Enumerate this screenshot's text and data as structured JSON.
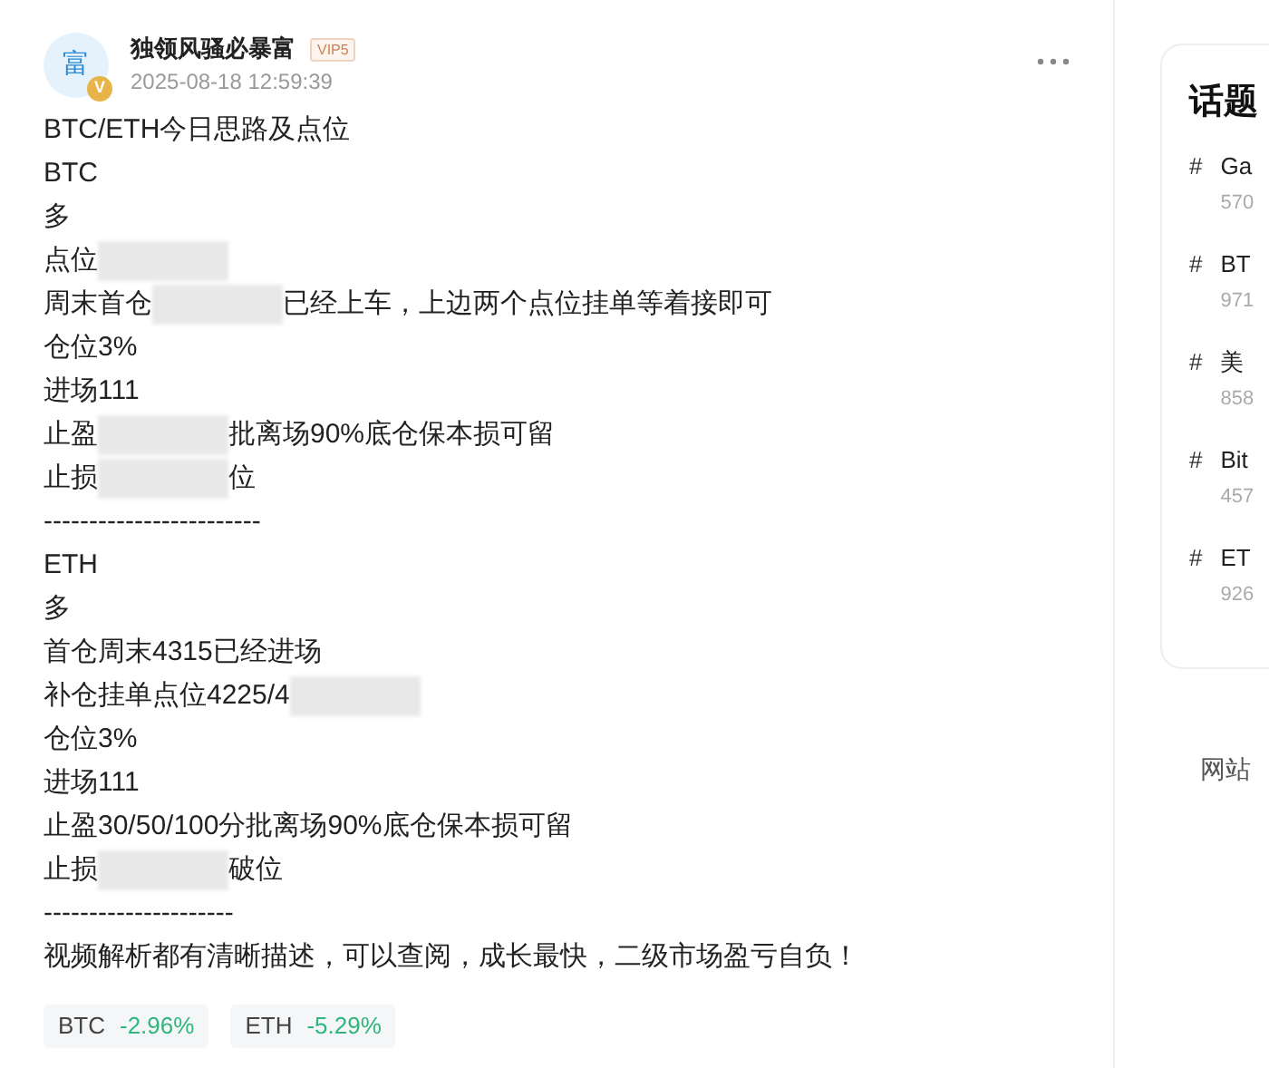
{
  "post": {
    "author": {
      "avatar_char": "富",
      "name": "独领风骚必暴富",
      "badge": "VIP5",
      "verified_mark": "V"
    },
    "timestamp": "2025-08-18 12:59:39",
    "lines": [
      [
        {
          "kind": "text",
          "text": "BTC/ETH今日思路及点位"
        }
      ],
      [
        {
          "kind": "text",
          "text": "BTC"
        }
      ],
      [
        {
          "kind": "text",
          "text": "多"
        }
      ],
      [
        {
          "kind": "text",
          "text": "点位"
        },
        {
          "kind": "redacted"
        }
      ],
      [
        {
          "kind": "text",
          "text": "周末首仓"
        },
        {
          "kind": "redacted"
        },
        {
          "kind": "text",
          "text": "已经上车，上边两个点位挂单等着接即可"
        }
      ],
      [
        {
          "kind": "text",
          "text": "仓位3%"
        }
      ],
      [
        {
          "kind": "text",
          "text": "进场111"
        }
      ],
      [
        {
          "kind": "text",
          "text": "止盈"
        },
        {
          "kind": "redacted"
        },
        {
          "kind": "text",
          "text": "批离场90%底仓保本损可留"
        }
      ],
      [
        {
          "kind": "text",
          "text": "止损"
        },
        {
          "kind": "redacted"
        },
        {
          "kind": "text",
          "text": "位"
        }
      ],
      [
        {
          "kind": "text",
          "text": "------------------------"
        }
      ],
      [
        {
          "kind": "text",
          "text": "ETH"
        }
      ],
      [
        {
          "kind": "text",
          "text": "多"
        }
      ],
      [
        {
          "kind": "text",
          "text": "首仓周末4315已经进场"
        }
      ],
      [
        {
          "kind": "text",
          "text": "补仓挂单点位4225/4"
        },
        {
          "kind": "redacted"
        }
      ],
      [
        {
          "kind": "text",
          "text": "仓位3%"
        }
      ],
      [
        {
          "kind": "text",
          "text": "进场111"
        }
      ],
      [
        {
          "kind": "text",
          "text": "止盈30/50/100分批离场90%底仓保本损可留"
        }
      ],
      [
        {
          "kind": "text",
          "text": "止损"
        },
        {
          "kind": "redacted"
        },
        {
          "kind": "text",
          "text": "破位"
        }
      ],
      [
        {
          "kind": "text",
          "text": "---------------------"
        }
      ],
      [
        {
          "kind": "text",
          "text": "视频解析都有清晰描述，可以查阅，成长最快，二级市场盈亏自负！"
        }
      ]
    ],
    "tickers": [
      {
        "symbol": "BTC",
        "change": "-2.96%"
      },
      {
        "symbol": "ETH",
        "change": "-5.29%"
      }
    ]
  },
  "sidebar": {
    "title": "话题",
    "topics": [
      {
        "title": "Ga",
        "count": "570"
      },
      {
        "title": "BT",
        "count": "971"
      },
      {
        "title": "美",
        "count": "858"
      },
      {
        "title": "Bit",
        "count": "457"
      },
      {
        "title": "ET",
        "count": "926"
      }
    ],
    "hash": "#",
    "footer": "网站"
  }
}
